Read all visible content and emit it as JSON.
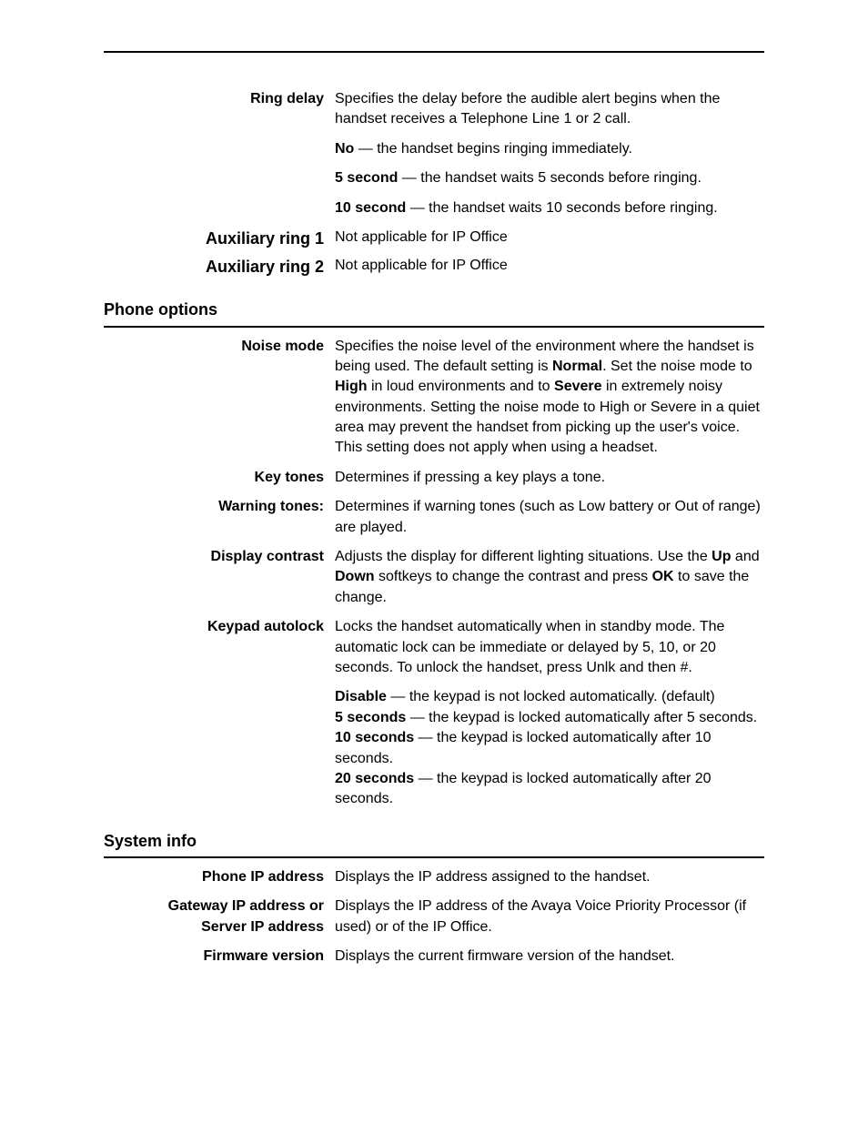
{
  "header_rule": true,
  "ring_delay": {
    "label": "Ring delay",
    "para1": "Specifies the delay before the audible alert begins when the handset receives a Telephone Line 1 or 2 call.",
    "options": {
      "no": "No",
      "no_suffix": " — the handset begins ringing immediately.",
      "five": "5 second",
      "five_suffix": " — the handset waits 5 seconds before ringing.",
      "ten": "10 second",
      "ten_suffix": " — the handset waits 10 seconds before ringing."
    }
  },
  "aux1": {
    "label": "Auxiliary ring 1",
    "body": "Not applicable for IP Office"
  },
  "aux2": {
    "label": "Auxiliary ring 2",
    "body": "Not applicable for IP Office"
  },
  "phone_options": {
    "heading": "Phone options",
    "noise_mode": {
      "label": "Noise mode",
      "text_before": "Specifies the noise level of the environment where the handset is being used. The default setting is ",
      "normal": "Normal",
      "text_mid1": ". Set the noise mode to ",
      "high": "High",
      "text_mid2": " in loud environments and to ",
      "severe": "Severe",
      "text_mid3": " in extremely noisy environments. Setting the noise mode to High or Severe in a quiet area may prevent the handset from picking up the user's voice. This setting does not apply when using a headset."
    },
    "key_tones": {
      "label": "Key tones",
      "body": "Determines if pressing a key plays a tone."
    },
    "warning_tones": {
      "label": "Warning tones:",
      "body": "Determines if warning tones (such as Low battery or Out of range) are played."
    },
    "display_contrast": {
      "label": "Display contrast",
      "pre": "Adjusts the display for different lighting situations. Use the ",
      "up": "Up",
      "and": " and ",
      "down": "Down",
      "mid": " softkeys to change the contrast and press ",
      "ok": "OK",
      "post": " to save the change."
    },
    "keypad_autolock": {
      "label": "Keypad autolock",
      "para": "Locks the handset automatically when in standby mode. The automatic lock can be immediate or delayed by 5, 10, or 20 seconds. To unlock the handset, press Unlk and then #.",
      "opts": {
        "disable": "Disable",
        "disable_suffix": " — the keypad is not locked automatically. (default)",
        "s5": "5 seconds",
        "s5_suffix": " — the keypad is locked automatically after 5 seconds.",
        "s10": "10 seconds",
        "s10_suffix": " — the keypad is locked automatically after 10 seconds.",
        "s20": "20 seconds",
        "s20_suffix": " — the keypad is locked automatically after 20 seconds."
      }
    }
  },
  "system_info": {
    "heading": "System info",
    "phone_ip": {
      "label": "Phone IP address",
      "body": "Displays the IP address assigned to the handset."
    },
    "gateway_ip": {
      "label_l1": "Gateway IP address or",
      "label_l2": "Server IP address",
      "body": "Displays the IP address of the Avaya Voice Priority Processor (if used) or of the IP Office."
    },
    "firmware": {
      "label": "Firmware version",
      "body": "Displays the current firmware version of the handset."
    }
  }
}
